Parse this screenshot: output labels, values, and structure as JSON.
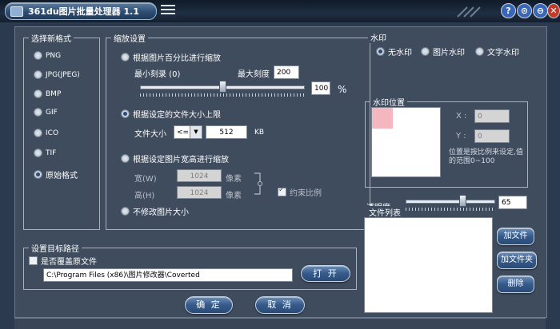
{
  "title": "361du图片批量处理器 1.1",
  "window_buttons": [
    "?",
    "⊙",
    "⊖",
    "✕"
  ],
  "colors": {
    "accent": "#355a8a",
    "panel": "#3f4c5e",
    "help": "#3a66b8",
    "close": "#c23a2a"
  },
  "format": {
    "title": "选择新格式",
    "options": [
      "PNG",
      "JPG(JPEG)",
      "BMP",
      "GIF",
      "ICO",
      "TIF",
      "原始格式"
    ],
    "selected": "原始格式"
  },
  "scale": {
    "title": "缩放设置",
    "by_percent": "根据图片百分比进行缩放",
    "min_label": "最小刻录 (0)",
    "max_label": "最大刻度",
    "max_value": "200",
    "percent_value": "100",
    "percent_unit": "%",
    "percent_fraction": 0.5,
    "by_filesize": "根据设定的文件大小上限",
    "filesize_label": "文件大小",
    "filesize_op": "<=",
    "filesize_value": "512",
    "filesize_unit": "KB",
    "by_dimensions": "根据设定图片宽高进行缩放",
    "width_label": "宽(W)",
    "width_value": "1024",
    "height_label": "高(H)",
    "height_value": "1024",
    "px_unit": "像素",
    "keep_ratio": "约束比例",
    "no_resize": "不修改图片大小",
    "selected": "根据设定的文件大小上限"
  },
  "watermark": {
    "title": "水印",
    "options": [
      "无水印",
      "图片水印",
      "文字水印"
    ],
    "selected": "无水印",
    "position_title": "水印位置",
    "x_label": "X :",
    "x_value": "0",
    "y_label": "Y :",
    "y_value": "0",
    "hint": "位置是按比例来设定,值的范围0~100",
    "opacity_label": "透明度",
    "opacity_value": "65",
    "opacity_fraction": 0.65
  },
  "files": {
    "title": "文件列表",
    "add_file": "加文件",
    "add_folder": "加文件夹",
    "delete": "删除"
  },
  "target": {
    "title": "设置目标路径",
    "overwrite": "是否覆盖原文件",
    "path": "C:\\Program Files (x86)\\图片修改器\\Coverted",
    "open": "打 开"
  },
  "actions": {
    "ok": "确 定",
    "cancel": "取 消"
  }
}
